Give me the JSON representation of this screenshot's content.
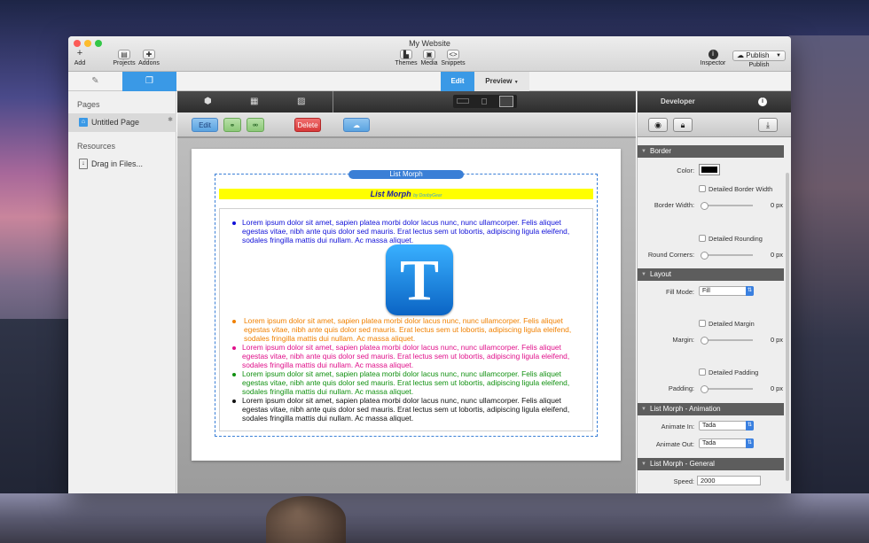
{
  "window": {
    "title": "My Website"
  },
  "toolbar": {
    "add_label": "Add",
    "projects_label": "Projects",
    "addons_label": "Addons",
    "themes_label": "Themes",
    "media_label": "Media",
    "snippets_label": "Snippets",
    "inspector_label": "Inspector",
    "publish_button": "Publish",
    "publish_label": "Publish"
  },
  "mode_tabs": {
    "edit": "Edit",
    "preview": "Preview"
  },
  "sidebar": {
    "pages_header": "Pages",
    "pages": [
      "Untitled Page"
    ],
    "resources_header": "Resources",
    "drag_files": "Drag in Files..."
  },
  "edit_bar": {
    "edit_label": "Edit",
    "delete_label": "Delete"
  },
  "canvas": {
    "morph_label": "List Morph",
    "header_title": "List Morph",
    "header_sub": "by DoobyGear",
    "items": [
      {
        "text": "Lorem ipsum dolor sit amet, sapien platea morbi dolor lacus nunc, nunc ullamcorper. Felis aliquet egestas vitae, nibh ante quis dolor sed mauris. Erat lectus sem ut lobortis, adipiscing ligula eleifend, sodales fringilla mattis dui nullam. Ac massa aliquet.",
        "color": "#1010d8"
      },
      {
        "text": "Lorem ipsum dolor sit amet, sapien platea morbi dolor lacus nunc, nunc ullamcorper. Felis aliquet egestas vitae, nibh ante quis dolor sed mauris. Erat lectus sem ut lobortis, adipiscing ligula eleifend, sodales fringilla mattis dui nullam. Ac massa aliquet.",
        "color": "#f08000"
      },
      {
        "text": "Lorem ipsum dolor sit amet, sapien platea morbi dolor lacus nunc, nunc ullamcorper. Felis aliquet egestas vitae, nibh ante quis dolor sed mauris. Erat lectus sem ut lobortis, adipiscing ligula eleifend, sodales fringilla mattis dui nullam. Ac massa aliquet.",
        "color": "#e0108a"
      },
      {
        "text": "Lorem ipsum dolor sit amet, sapien platea morbi dolor lacus nunc, nunc ullamcorper. Felis aliquet egestas vitae, nibh ante quis dolor sed mauris. Erat lectus sem ut lobortis, adipiscing ligula eleifend, sodales fringilla mattis dui nullam. Ac massa aliquet.",
        "color": "#109010"
      },
      {
        "text": "Lorem ipsum dolor sit amet, sapien platea morbi dolor lacus nunc, nunc ullamcorper. Felis aliquet egestas vitae, nibh ante quis dolor sed mauris. Erat lectus sem ut lobortis, adipiscing ligula eleifend, sodales fringilla mattis dui nullam. Ac massa aliquet.",
        "color": "#111111"
      }
    ],
    "icon_letter": "T"
  },
  "inspector": {
    "title": "Developer",
    "border": {
      "header": "Border",
      "color_label": "Color:",
      "color_value": "#000000",
      "detailed_width": "Detailed Border Width",
      "width_label": "Border Width:",
      "width_value": "0 px",
      "detailed_rounding": "Detailed Rounding",
      "corners_label": "Round Corners:",
      "corners_value": "0 px"
    },
    "layout": {
      "header": "Layout",
      "fill_label": "Fill Mode:",
      "fill_value": "Fill",
      "detailed_margin": "Detailed Margin",
      "margin_label": "Margin:",
      "margin_value": "0 px",
      "detailed_padding": "Detailed Padding",
      "padding_label": "Padding:",
      "padding_value": "0 px"
    },
    "animation": {
      "header": "List Morph - Animation",
      "in_label": "Animate In:",
      "in_value": "Tada",
      "out_label": "Animate Out:",
      "out_value": "Tada"
    },
    "general": {
      "header": "List Morph - General",
      "speed_label": "Speed:",
      "speed_value": "2000"
    }
  },
  "colors": {
    "accent": "#3a99e6",
    "delete": "#e04848"
  }
}
